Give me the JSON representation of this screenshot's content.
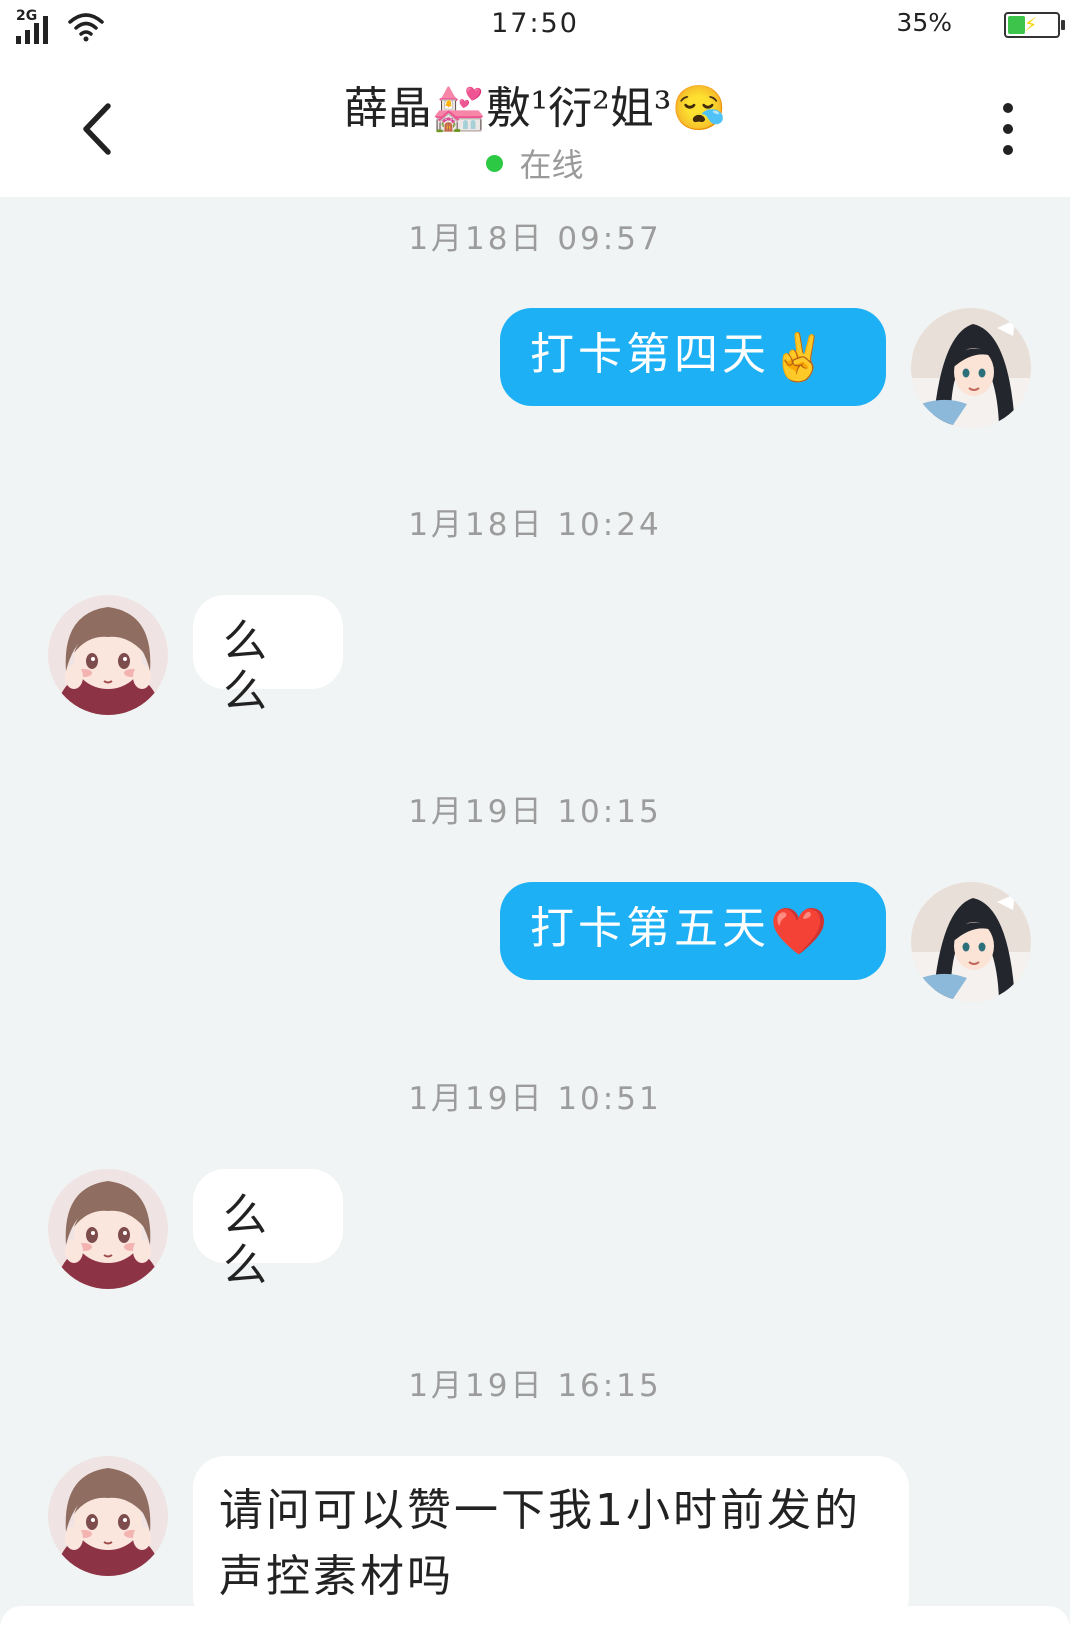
{
  "status_bar": {
    "network": "2G",
    "time": "17:50",
    "battery_percent_text": "35%",
    "battery_level": 0.35,
    "icons": [
      "signal-icon",
      "wifi-icon",
      "battery-icon",
      "charging-icon"
    ]
  },
  "header": {
    "contact_name": "薛晶💒敷¹衍²姐³😪",
    "status": "在线",
    "back_icon": "chevron-left-icon",
    "more_icon": "more-vertical-icon"
  },
  "colors": {
    "outgoing_bubble": "#1eb0f4",
    "incoming_bubble": "#ffffff",
    "chat_background": "#f1f4f4",
    "online_dot": "#2bc944"
  },
  "messages": [
    {
      "timestamp": "1月18日 09:57",
      "sender": "me",
      "text": "打卡第四天",
      "emoji": "✌️"
    },
    {
      "timestamp": "1月18日 10:24",
      "sender": "them",
      "text": "么么"
    },
    {
      "timestamp": "1月19日 10:15",
      "sender": "me",
      "text": "打卡第五天",
      "emoji": "❤️"
    },
    {
      "timestamp": "1月19日 10:51",
      "sender": "them",
      "text": "么么"
    },
    {
      "timestamp": "1月19日 16:15",
      "sender": "them",
      "text": "请问可以赞一下我1小时前发的声控素材吗"
    }
  ]
}
